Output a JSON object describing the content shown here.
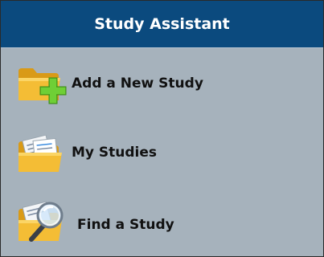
{
  "header": {
    "title": "Study Assistant"
  },
  "items": [
    {
      "label": "Add a New Study",
      "icon": "folder-add-icon"
    },
    {
      "label": "My Studies",
      "icon": "folder-documents-icon"
    },
    {
      "label": "Find a Study",
      "icon": "folder-search-icon"
    }
  ],
  "colors": {
    "header_bg": "#0b4a7e",
    "panel_bg": "#a6b2bc",
    "folder": "#f2b62c",
    "plus": "#5fbd2a"
  }
}
